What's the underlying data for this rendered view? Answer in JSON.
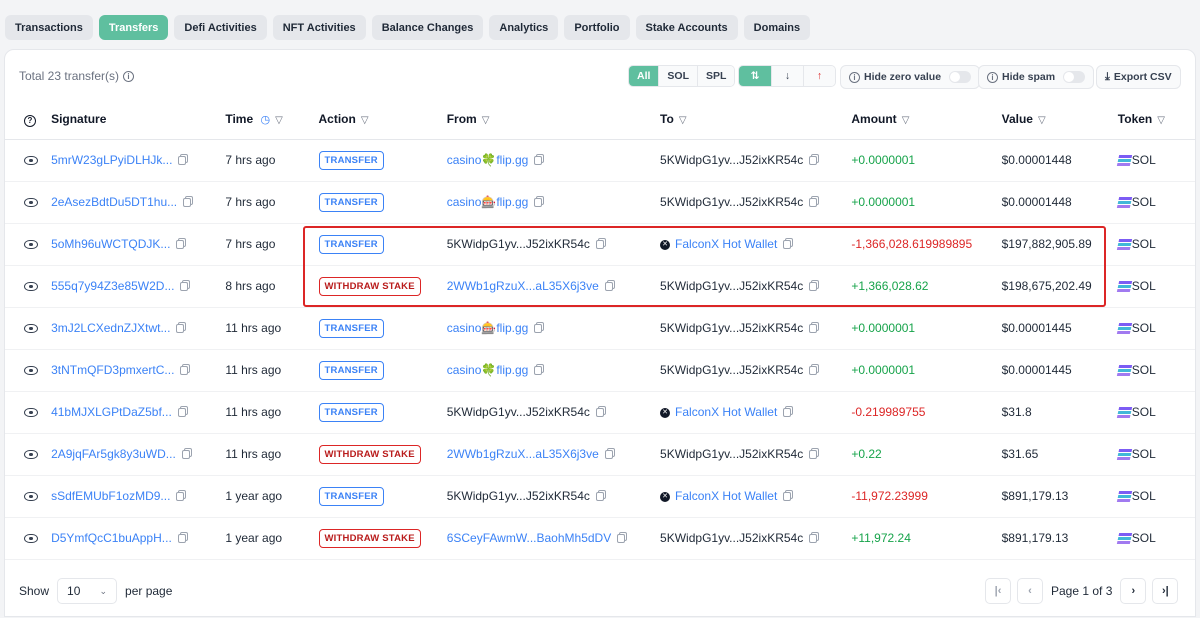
{
  "tabs": [
    "Transactions",
    "Transfers",
    "Defi Activities",
    "NFT Activities",
    "Balance Changes",
    "Analytics",
    "Portfolio",
    "Stake Accounts",
    "Domains"
  ],
  "active_tab": "Transfers",
  "summary": {
    "total_text": "Total 23 transfer(s)"
  },
  "token_filter": [
    "All",
    "SOL",
    "SPL"
  ],
  "active_token_filter": "All",
  "controls": {
    "hide_zero": "Hide zero value",
    "hide_spam": "Hide spam",
    "export": "Export CSV"
  },
  "columns": [
    "Signature",
    "Time",
    "Action",
    "From",
    "To",
    "Amount",
    "Value",
    "Token"
  ],
  "rows": [
    {
      "signature": "5mrW23gLPyiDLHJk...",
      "time": "7 hrs ago",
      "action": "TRANSFER",
      "from": "casino🍀flip.gg",
      "from_link": true,
      "to": "5KWidpG1yv...J52ixKR54c",
      "to_link": false,
      "amount": "+0.0000001",
      "value": "$0.00001448",
      "token": "SOL"
    },
    {
      "signature": "2eAsezBdtDu5DT1hu...",
      "time": "7 hrs ago",
      "action": "TRANSFER",
      "from": "casino🎰flip.gg",
      "from_link": true,
      "to": "5KWidpG1yv...J52ixKR54c",
      "to_link": false,
      "amount": "+0.0000001",
      "value": "$0.00001448",
      "token": "SOL"
    },
    {
      "signature": "5oMh96uWCTQDJK...",
      "time": "7 hrs ago",
      "action": "TRANSFER",
      "from": "5KWidpG1yv...J52ixKR54c",
      "from_link": false,
      "to": "FalconX Hot Wallet",
      "to_link": true,
      "amount": "-1,366,028.619989895",
      "value": "$197,882,905.89",
      "token": "SOL"
    },
    {
      "signature": "555q7y94Z3e85W2D...",
      "time": "8 hrs ago",
      "action": "WITHDRAW STAKE",
      "from": "2WWb1gRzuX...aL35X6j3ve",
      "from_link": true,
      "to": "5KWidpG1yv...J52ixKR54c",
      "to_link": false,
      "amount": "+1,366,028.62",
      "value": "$198,675,202.49",
      "token": "SOL"
    },
    {
      "signature": "3mJ2LCXednZJXtwt...",
      "time": "11 hrs ago",
      "action": "TRANSFER",
      "from": "casino🎰flip.gg",
      "from_link": true,
      "to": "5KWidpG1yv...J52ixKR54c",
      "to_link": false,
      "amount": "+0.0000001",
      "value": "$0.00001445",
      "token": "SOL"
    },
    {
      "signature": "3tNTmQFD3pmxertC...",
      "time": "11 hrs ago",
      "action": "TRANSFER",
      "from": "casino🍀flip.gg",
      "from_link": true,
      "to": "5KWidpG1yv...J52ixKR54c",
      "to_link": false,
      "amount": "+0.0000001",
      "value": "$0.00001445",
      "token": "SOL"
    },
    {
      "signature": "41bMJXLGPtDaZ5bf...",
      "time": "11 hrs ago",
      "action": "TRANSFER",
      "from": "5KWidpG1yv...J52ixKR54c",
      "from_link": false,
      "to": "FalconX Hot Wallet",
      "to_link": true,
      "amount": "-0.219989755",
      "value": "$31.8",
      "token": "SOL"
    },
    {
      "signature": "2A9jqFAr5gk8y3uWD...",
      "time": "11 hrs ago",
      "action": "WITHDRAW STAKE",
      "from": "2WWb1gRzuX...aL35X6j3ve",
      "from_link": true,
      "to": "5KWidpG1yv...J52ixKR54c",
      "to_link": false,
      "amount": "+0.22",
      "value": "$31.65",
      "token": "SOL"
    },
    {
      "signature": "sSdfEMUbF1ozMD9...",
      "time": "1 year ago",
      "action": "TRANSFER",
      "from": "5KWidpG1yv...J52ixKR54c",
      "from_link": false,
      "to": "FalconX Hot Wallet",
      "to_link": true,
      "amount": "-11,972.23999",
      "value": "$891,179.13",
      "token": "SOL"
    },
    {
      "signature": "D5YmfQcC1buAppH...",
      "time": "1 year ago",
      "action": "WITHDRAW STAKE",
      "from": "6SCeyFAwmW...BaohMh5dDV",
      "from_link": true,
      "to": "5KWidpG1yv...J52ixKR54c",
      "to_link": false,
      "amount": "+11,972.24",
      "value": "$891,179.13",
      "token": "SOL"
    }
  ],
  "pagination": {
    "show_label": "Show",
    "per_page_value": "10",
    "per_page_label": "per page",
    "page_text": "Page 1 of 3"
  },
  "colors": {
    "accent": "#5fbf9f",
    "link": "#3b82f6",
    "positive": "#16a34a",
    "negative": "#dc2626",
    "highlight_box": "#dc2626"
  }
}
